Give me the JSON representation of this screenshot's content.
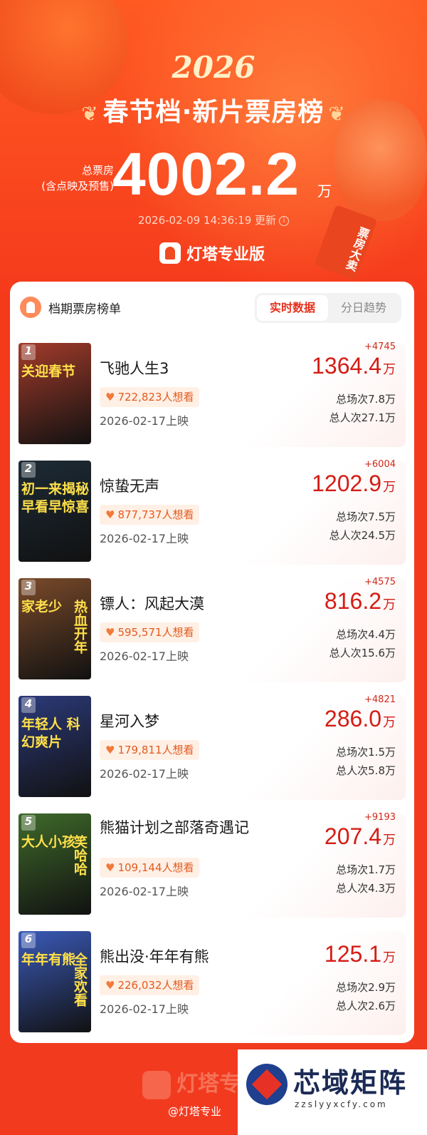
{
  "header": {
    "year": "2026",
    "title": "春节档·新片票房榜",
    "total_label_1": "总票房",
    "total_label_2": "(含点映及预售)",
    "total_value": "4002.2",
    "total_unit": "万",
    "updated": "2026-02-09 14:36:19 更新",
    "brand": "灯塔专业版",
    "tag": "票房大卖"
  },
  "card": {
    "title": "档期票房榜单",
    "tabs": [
      {
        "label": "实时数据",
        "active": true
      },
      {
        "label": "分日趋势",
        "active": false
      }
    ]
  },
  "movies": [
    {
      "rank": "1",
      "name": "飞驰人生3",
      "want": "722,823人想看",
      "date": "2026-02-17上映",
      "delta": "+4745",
      "box": "1364.4",
      "unit": "万",
      "sessions": "总场次7.8万",
      "audience": "总人次27.1万",
      "poster_text": "关迎春节",
      "poster_text2": "",
      "poster_color": "#a23b2a"
    },
    {
      "rank": "2",
      "name": "惊蛰无声",
      "want": "877,737人想看",
      "date": "2026-02-17上映",
      "delta": "+6004",
      "box": "1202.9",
      "unit": "万",
      "sessions": "总场次7.5万",
      "audience": "总人次24.5万",
      "poster_text": "初一来揭秘 早看早惊喜",
      "poster_text2": "",
      "poster_color": "#1d2b36"
    },
    {
      "rank": "3",
      "name": "镖人：风起大漠",
      "want": "595,571人想看",
      "date": "2026-02-17上映",
      "delta": "+4575",
      "box": "816.2",
      "unit": "万",
      "sessions": "总场次4.4万",
      "audience": "总人次15.6万",
      "poster_text": "家老少",
      "poster_text2": "热血开年",
      "poster_color": "#7a4a2a"
    },
    {
      "rank": "4",
      "name": "星河入梦",
      "want": "179,811人想看",
      "date": "2026-02-17上映",
      "delta": "+4821",
      "box": "286.0",
      "unit": "万",
      "sessions": "总场次1.5万",
      "audience": "总人次5.8万",
      "poster_text": "年轻人 科幻爽片",
      "poster_text2": "",
      "poster_color": "#2c3a7a"
    },
    {
      "rank": "5",
      "name": "熊猫计划之部落奇遇记",
      "want": "109,144人想看",
      "date": "2026-02-17上映",
      "delta": "+9193",
      "box": "207.4",
      "unit": "万",
      "sessions": "总场次1.7万",
      "audience": "总人次4.3万",
      "poster_text": "大人小孩",
      "poster_text2": "笑哈哈",
      "poster_color": "#3f6a2a"
    },
    {
      "rank": "6",
      "name": "熊出没·年年有熊",
      "want": "226,032人想看",
      "date": "2026-02-17上映",
      "delta": "",
      "box": "125.1",
      "unit": "万",
      "sessions": "总场次2.9万",
      "audience": "总人次2.6万",
      "poster_text": "年年有熊",
      "poster_text2": "全家欢看",
      "poster_color": "#3a5ab8"
    }
  ],
  "watermark": {
    "brand": "灯塔专",
    "weibo": "@灯塔专业"
  },
  "site": {
    "name": "芯域矩阵",
    "url": "zzslyyxcfy.com"
  },
  "icons": [
    "info-icon",
    "heart-icon",
    "dengta-logo-icon"
  ]
}
